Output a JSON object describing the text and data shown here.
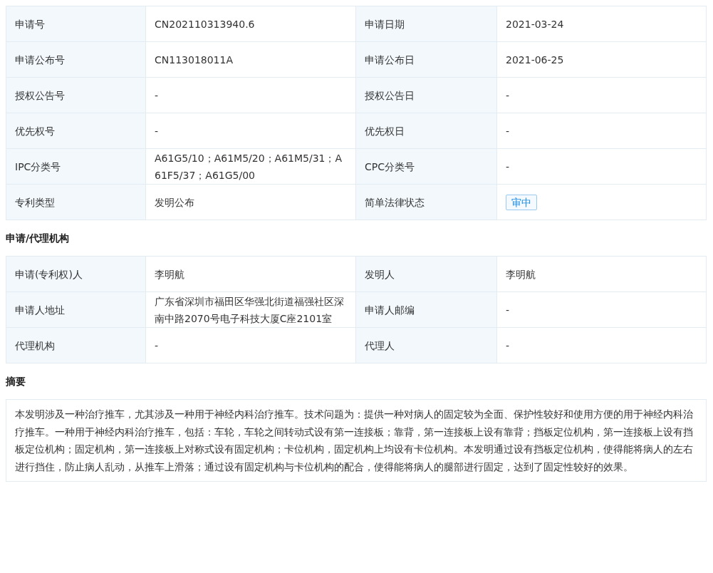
{
  "basic_info": {
    "rows": [
      {
        "cells": [
          {
            "kind": "label",
            "text": "申请号"
          },
          {
            "kind": "value",
            "text": "CN202110313940.6"
          },
          {
            "kind": "label",
            "text": "申请日期"
          },
          {
            "kind": "value",
            "text": "2021-03-24"
          }
        ]
      },
      {
        "cells": [
          {
            "kind": "label",
            "text": "申请公布号"
          },
          {
            "kind": "value",
            "text": "CN113018011A"
          },
          {
            "kind": "label",
            "text": "申请公布日"
          },
          {
            "kind": "value",
            "text": "2021-06-25"
          }
        ]
      },
      {
        "cells": [
          {
            "kind": "label",
            "text": "授权公告号"
          },
          {
            "kind": "value",
            "text": "-"
          },
          {
            "kind": "label",
            "text": "授权公告日"
          },
          {
            "kind": "value",
            "text": "-"
          }
        ]
      },
      {
        "cells": [
          {
            "kind": "label",
            "text": "优先权号"
          },
          {
            "kind": "value",
            "text": "-"
          },
          {
            "kind": "label",
            "text": "优先权日"
          },
          {
            "kind": "value",
            "text": "-"
          }
        ]
      },
      {
        "cells": [
          {
            "kind": "label",
            "text": "IPC分类号"
          },
          {
            "kind": "value",
            "text": "A61G5/10；A61M5/20；A61M5/31；A61F5/37；A61G5/00"
          },
          {
            "kind": "label",
            "text": "CPC分类号"
          },
          {
            "kind": "value",
            "text": "-"
          }
        ]
      },
      {
        "cells": [
          {
            "kind": "label",
            "text": "专利类型"
          },
          {
            "kind": "value",
            "text": "发明公布"
          },
          {
            "kind": "label",
            "text": "简单法律状态"
          },
          {
            "kind": "tag",
            "text": "审中"
          }
        ]
      }
    ]
  },
  "applicant_section": {
    "title": "申请/代理机构",
    "rows": [
      {
        "cells": [
          {
            "kind": "label",
            "text": "申请(专利权)人"
          },
          {
            "kind": "value",
            "text": "李明航"
          },
          {
            "kind": "label",
            "text": "发明人"
          },
          {
            "kind": "value",
            "text": "李明航"
          }
        ]
      },
      {
        "cells": [
          {
            "kind": "label",
            "text": "申请人地址"
          },
          {
            "kind": "value",
            "text": "广东省深圳市福田区华强北街道福强社区深南中路2070号电子科技大厦C座2101室"
          },
          {
            "kind": "label",
            "text": "申请人邮编"
          },
          {
            "kind": "value",
            "text": "-"
          }
        ]
      },
      {
        "cells": [
          {
            "kind": "label",
            "text": "代理机构"
          },
          {
            "kind": "value",
            "text": "-"
          },
          {
            "kind": "label",
            "text": "代理人"
          },
          {
            "kind": "value",
            "text": "-"
          }
        ]
      }
    ]
  },
  "abstract": {
    "title": "摘要",
    "text": "本发明涉及一种治疗推车，尤其涉及一种用于神经内科治疗推车。技术问题为：提供一种对病人的固定较为全面、保护性较好和使用方便的用于神经内科治疗推车。一种用于神经内科治疗推车，包括：车轮，车轮之间转动式设有第一连接板；靠背，第一连接板上设有靠背；挡板定位机构，第一连接板上设有挡板定位机构；固定机构，第一连接板上对称式设有固定机构；卡位机构，固定机构上均设有卡位机构。本发明通过设有挡板定位机构，使得能将病人的左右进行挡住，防止病人乱动，从推车上滑落；通过设有固定机构与卡位机构的配合，使得能将病人的腿部进行固定，达到了固定性较好的效果。"
  }
}
